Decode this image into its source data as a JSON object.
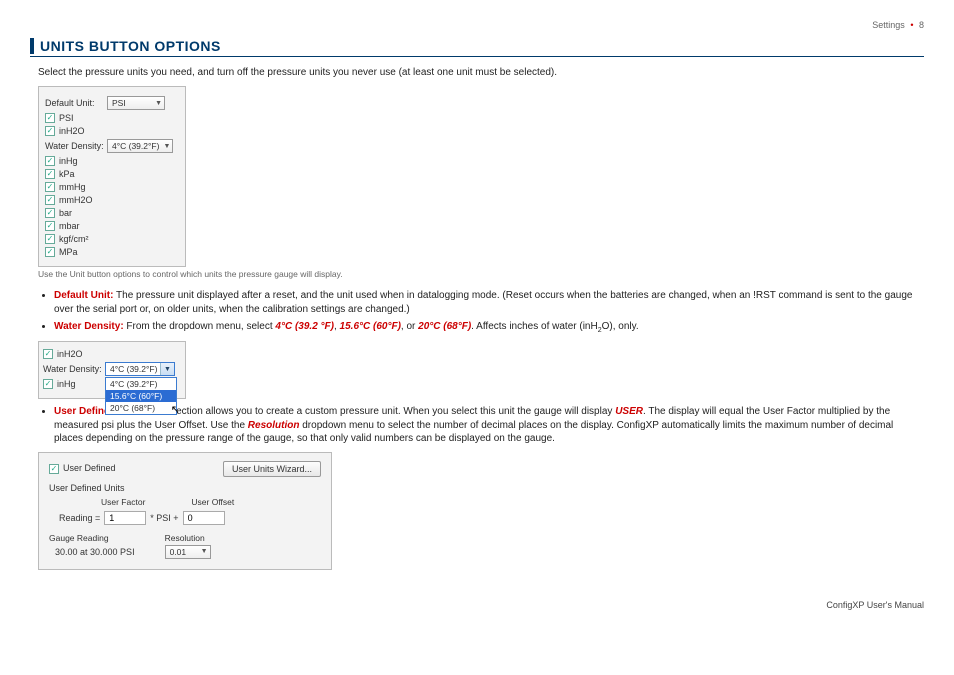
{
  "header": {
    "section": "Settings",
    "page": "8"
  },
  "title": "Units Button Options",
  "intro": "Select the pressure units you need, and turn off the pressure units you never use (at least one unit must be selected).",
  "panel1": {
    "default_label": "Default Unit:",
    "default_value": "PSI",
    "wd_label": "Water Density:",
    "wd_value": "4°C (39.2°F)",
    "units": [
      "PSI",
      "inH2O",
      "inHg",
      "kPa",
      "mmHg",
      "mmH2O",
      "bar",
      "mbar",
      "kgf/cm²",
      "MPa"
    ]
  },
  "caption": "Use the Unit button options to control which units the pressure gauge will display.",
  "bullets": {
    "b1_term": "Default Unit:",
    "b1_text": " The pressure unit displayed after a reset, and the unit used when in datalogging mode. (Reset occurs when the batteries are changed, when an !RST command is sent to the gauge over the serial port or, on older units, when the calibration settings are changed.)",
    "b2_term": "Water Density:",
    "b2_pre": " From the dropdown menu, select ",
    "b2_o1": "4°C (39.2 °F)",
    "b2_c1": ", ",
    "b2_o2": "15.6°C (60°F)",
    "b2_c2": ", or ",
    "b2_o3": "20°C (68°F)",
    "b2_post": ". Affects inches of water (inH",
    "b2_post2": "O), only.",
    "b3_term": "User Defined Units:",
    "b3_text_a": " This section allows you to create a custom pressure unit. When you select this unit the gauge will display ",
    "b3_user": "USER",
    "b3_text_b": ". The display will equal the User Factor multiplied by the measured psi plus the User Offset. Use the ",
    "b3_res": "Resolution",
    "b3_text_c": " dropdown menu to select the number of decimal places on the display. ConfigXP automatically limits the maximum number of decimal places depending on the pressure range of the gauge, so that only valid numbers can be displayed on the gauge."
  },
  "panel2": {
    "u1": "inH2O",
    "wd_label": "Water Density:",
    "sel": "4°C (39.2°F)",
    "opts": [
      "4°C (39.2°F)",
      "15.6°C (60°F)",
      "20°C (68°F)"
    ],
    "u2": "inHg"
  },
  "panel3": {
    "cb": "User Defined",
    "btn": "User Units Wizard...",
    "sub": "User Defined Units",
    "uf": "User Factor",
    "uo": "User Offset",
    "reading_lbl": "Reading =",
    "uf_val": "1",
    "psi_plus": "* PSI +",
    "uo_val": "0",
    "gr_hd": "Gauge Reading",
    "gr_val": "30.00 at 30.000 PSI",
    "res_hd": "Resolution",
    "res_val": "0.01"
  },
  "footer": "ConfigXP User's Manual"
}
